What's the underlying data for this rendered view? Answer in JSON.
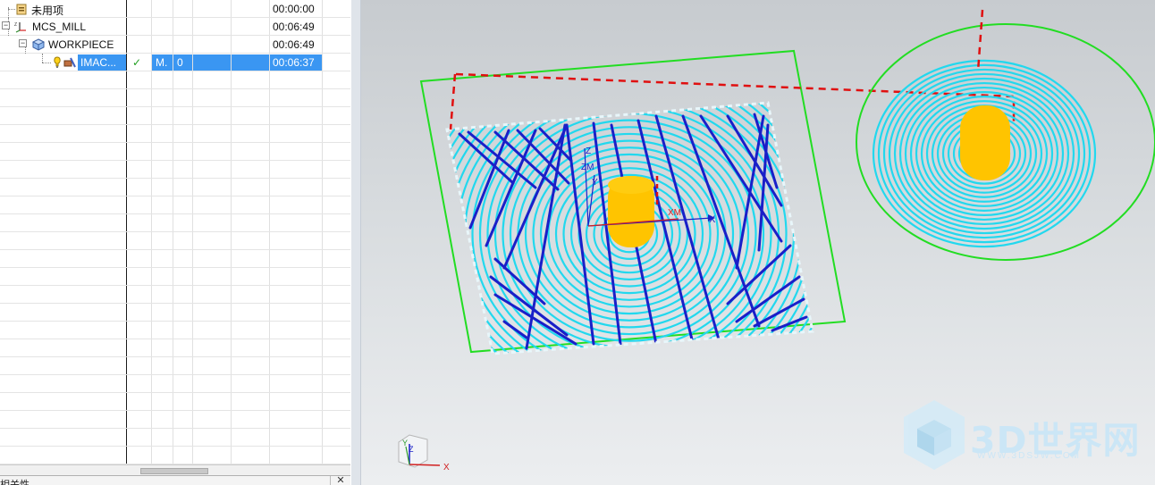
{
  "navigator": {
    "rows": [
      {
        "name": "未用项",
        "time": "00:00:00"
      },
      {
        "name": "MCS_MILL",
        "time": "00:06:49"
      },
      {
        "name": "WORKPIECE",
        "time": "00:06:49"
      },
      {
        "name": "IMAC...",
        "status": "✓",
        "col_m": "M.",
        "col_n": "0",
        "time": "00:06:37"
      }
    ],
    "bottom_panel_title": "相关性",
    "bottom_close": "✕"
  },
  "viewport": {
    "tool_triad": {
      "x_label": "X",
      "y_label": "Y",
      "z_label": "Z"
    },
    "wcs_labels": {
      "x": "X",
      "xm": "XM",
      "z": "Z",
      "zm": "ZM",
      "y": "Y"
    },
    "watermark": {
      "text": "3D世界网",
      "url": "WWW.3DSJW.COM"
    },
    "colors": {
      "toolpath_spiral": "#22d8ee",
      "toolpath_cut": "#1a1fc8",
      "blank": "#22dd22",
      "part": "#ffc400",
      "clearance": "#e01010"
    }
  }
}
